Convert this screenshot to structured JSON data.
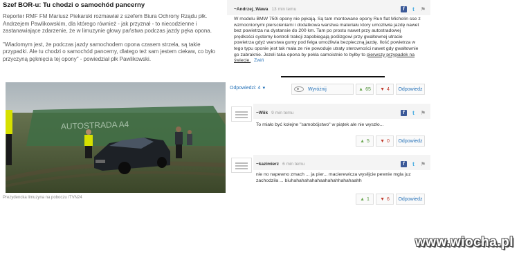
{
  "article": {
    "title": "Szef BOR-u: Tu chodzi o samochód pancerny",
    "paragraph1": "Reporter RMF FM Mariusz Piekarski rozmawiał z szefem Biura Ochrony Rządu płk. Andrzejem Pawlikowskim, dla którego również - jak przyznał - to niecodzienne i zastanawiające zdarzenie, że w limuzynie głowy państwa podczas jazdy pęka opona.",
    "paragraph2": "\"Wiadomym jest, że podczas jazdy samochodem opona czasem strzela, są takie przypadki. Ale tu chodzi o samochód pancerny, dlatego też sam jestem ciekaw, co było przyczyną pęknięcia tej opony\" - powiedział płk Pawlikowski.",
    "photo_sign": "AUTOSTRADA A4",
    "photo_caption": "Prezydencka limuzyna na poboczu /TVN24"
  },
  "comments": [
    {
      "author": "~Andrzej_Wawa",
      "time": "13 min temu",
      "body": "W modelu BMW 750i opony nie pękają. Są tam montowane opony Run flat Michelin sse z wzmocnionymi pierscieniami i dodatkowa warstwa materiału ktory umozliwia jazdę nawet bez powietrza na dystansie do 200 km. Tam po prostu nawet przy autostradowej prędkości systemy kontroli trakcji zapobiegają poślizgowi przy gwałtownej utracie powietrza gdyż warstwa gumy pod felga umożliwia bezpieczną jazdę. Ilość powietrza w tego typu oponie jest tak mała ze nie powoduje utraty sterowności nawet gdy gwałtownie go zabraknie. Jezeli taka opona by pekła samoistnie to byłby to",
      "body_underlined": "pierwszy przypadek na świecie.",
      "collapse": "Zwiń",
      "replies_label": "Odpowiedzi:",
      "replies_count": "4",
      "highlight_label": "Wyróżnij",
      "up": "65",
      "down": "4",
      "reply_label": "Odpowiedz"
    },
    {
      "author": "~Wiik",
      "time": "9 min temu",
      "body": "To miało być kolejne \"samobójstwo\" w piątek ale nie wyszło...",
      "up": "5",
      "down": "0",
      "reply_label": "Odpowiedz"
    },
    {
      "author": "~kazimierz",
      "time": "6 min temu",
      "body": "nie no napewno zmach ... ja pier... macierewicza wysłijcie pewnie mgla juz zachodziła ... biuhahahahahahaahahahhahahaahh",
      "up": "1",
      "down": "6",
      "reply_label": "Odpowiedz"
    }
  ],
  "watermark": "www.wiocha.pl",
  "colors": {
    "link": "#2672b8",
    "up": "#4a8d33",
    "down": "#c0392b",
    "facebook": "#3b5998",
    "twitter": "#3aa7e0"
  }
}
